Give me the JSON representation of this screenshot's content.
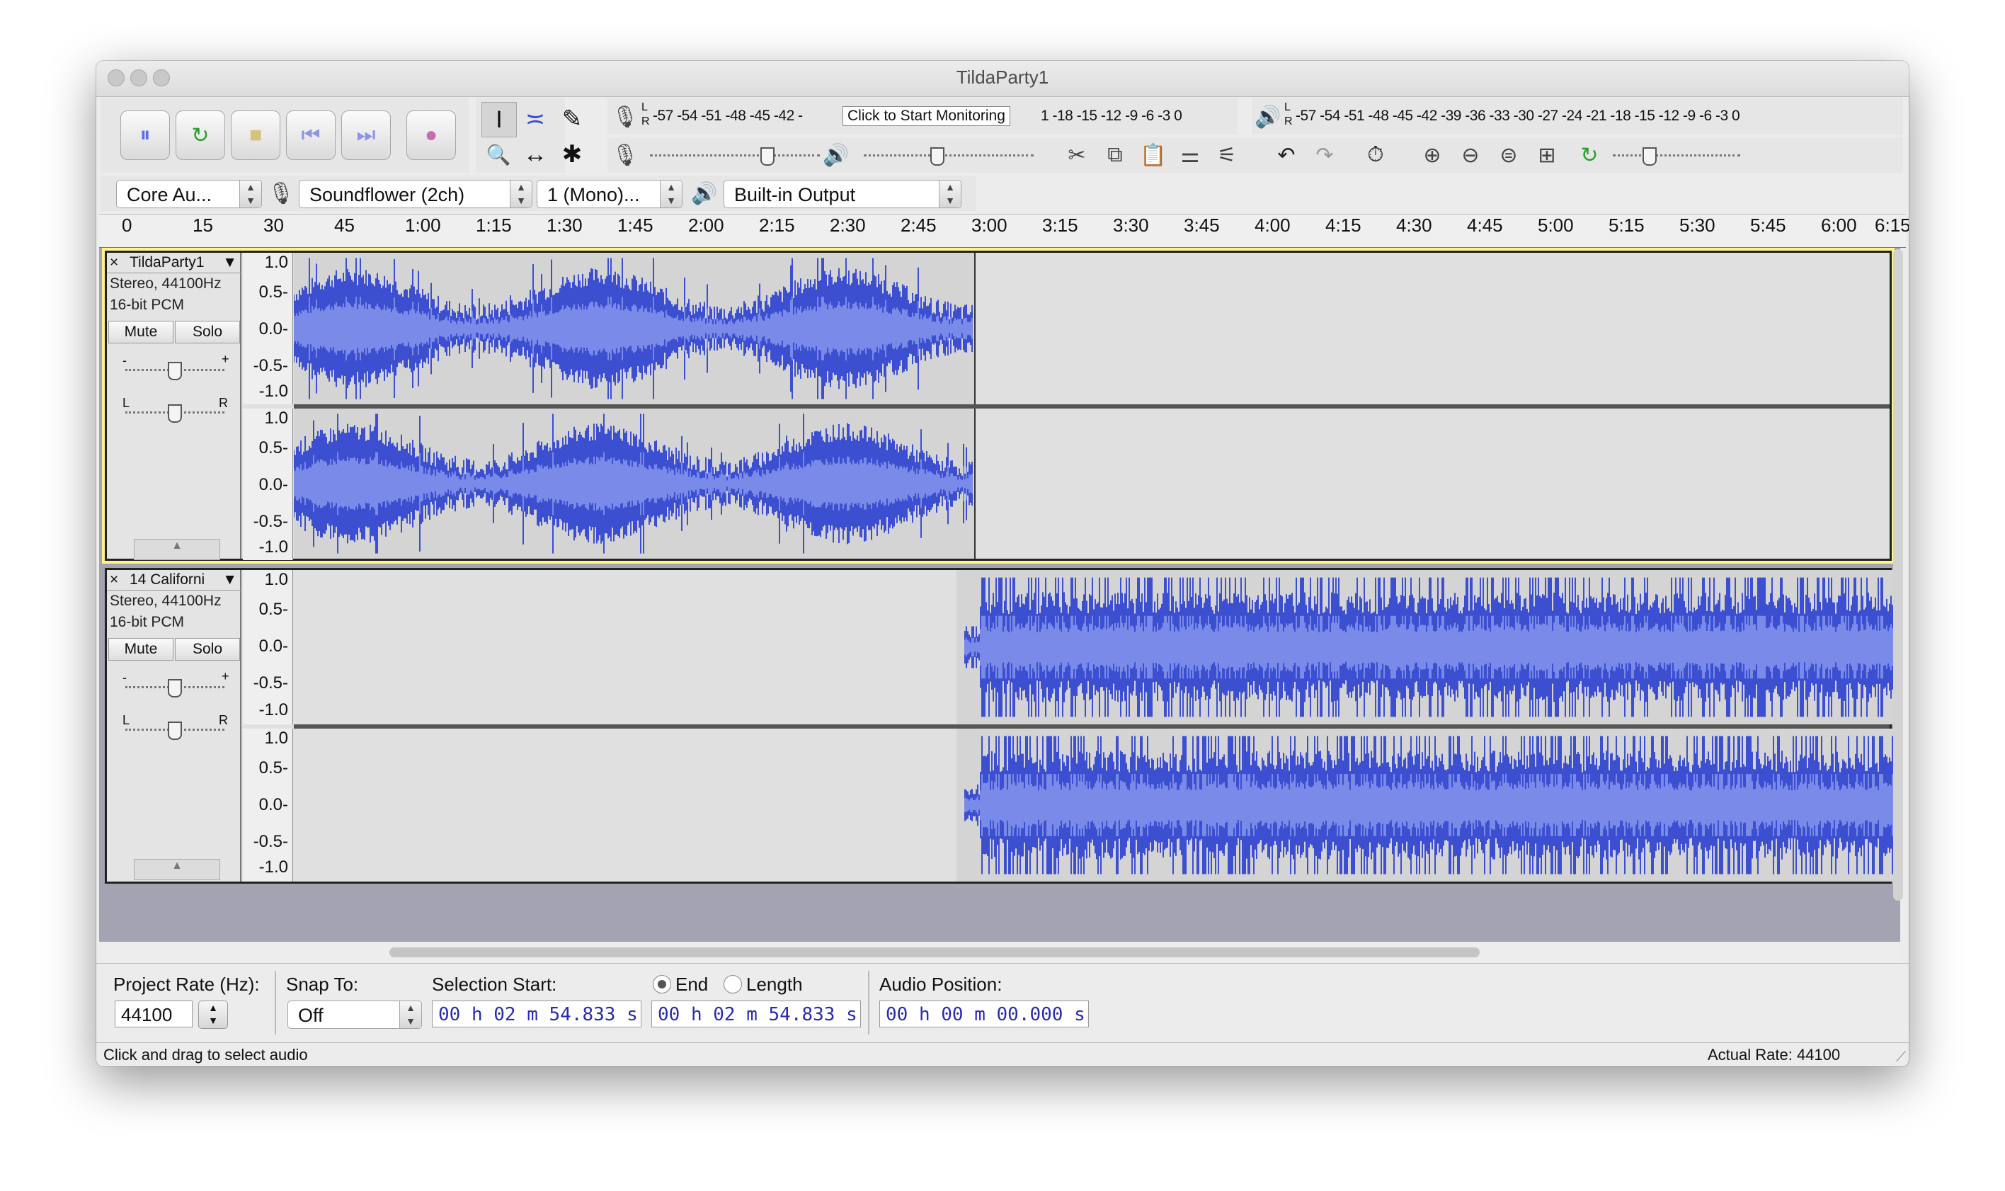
{
  "window": {
    "title": "TildaParty1"
  },
  "meter": {
    "record_scale": "-57 -54 -51 -48 -45 -42 -",
    "record_scale_tail": "1 -18 -15 -12  -9  -6  -3  0",
    "click_to_monitor": "Click to Start Monitoring",
    "play_scale": "-57 -54 -51 -48 -45 -42 -39 -36 -33 -30 -27 -24 -21 -18 -15 -12  -9  -6  -3  0",
    "record_L": "L",
    "record_R": "R",
    "play_L": "L",
    "play_R": "R"
  },
  "device": {
    "host": "Core Au...",
    "input": "Soundflower (2ch)",
    "channels": "1 (Mono)...",
    "output": "Built-in Output"
  },
  "ruler": [
    "0",
    "15",
    "30",
    "45",
    "1:00",
    "1:15",
    "1:30",
    "1:45",
    "2:00",
    "2:15",
    "2:30",
    "2:45",
    "3:00",
    "3:15",
    "3:30",
    "3:45",
    "4:00",
    "4:15",
    "4:30",
    "4:45",
    "5:00",
    "5:15",
    "5:30",
    "5:45",
    "6:00",
    "6:15"
  ],
  "tracks": [
    {
      "name": "TildaParty1",
      "format": "Stereo, 44100Hz",
      "bits": "16-bit PCM",
      "mute": "Mute",
      "solo": "Solo",
      "gain_minus": "-",
      "gain_plus": "+",
      "pan_l": "L",
      "pan_r": "R",
      "scale": [
        "1.0",
        "0.5-",
        "0.0-",
        "-0.5-",
        "-1.0"
      ]
    },
    {
      "name": "14 Californi",
      "format": "Stereo, 44100Hz",
      "bits": "16-bit PCM",
      "mute": "Mute",
      "solo": "Solo",
      "gain_minus": "-",
      "gain_plus": "+",
      "pan_l": "L",
      "pan_r": "R",
      "scale": [
        "1.0",
        "0.5-",
        "0.0-",
        "-0.5-",
        "-1.0"
      ]
    }
  ],
  "selection": {
    "project_rate_label": "Project Rate (Hz):",
    "project_rate_value": "44100",
    "snap_label": "Snap To:",
    "snap_value": "Off",
    "sel_start_label": "Selection Start:",
    "end_label": "End",
    "length_label": "Length",
    "audio_pos_label": "Audio Position:",
    "sel_start": "00 h 02 m 54.833 s",
    "sel_end": "00 h 02 m 54.833 s",
    "audio_pos": "00 h 00 m 00.000 s"
  },
  "status": {
    "left": "Click and drag to select audio",
    "right": "Actual Rate: 44100"
  },
  "colors": {
    "waveform": "#3c4fd0",
    "waveform_rms": "#7a8ae8",
    "track_bg": "#e0e0e0",
    "focus": "#fff48a"
  },
  "icons": {
    "pause": "⏸",
    "loop": "↻",
    "stop": "■",
    "skip_start": "⏮",
    "skip_end": "⏭",
    "record": "●",
    "selection_tool": "I",
    "envelope_tool": "≍",
    "draw_tool": "✎",
    "zoom_tool": "🔍",
    "timeshift_tool": "↔",
    "multi_tool": "✱",
    "mic": "🎤",
    "speaker": "🔊",
    "undo": "↶",
    "redo": "↷",
    "timer": "⏱"
  }
}
